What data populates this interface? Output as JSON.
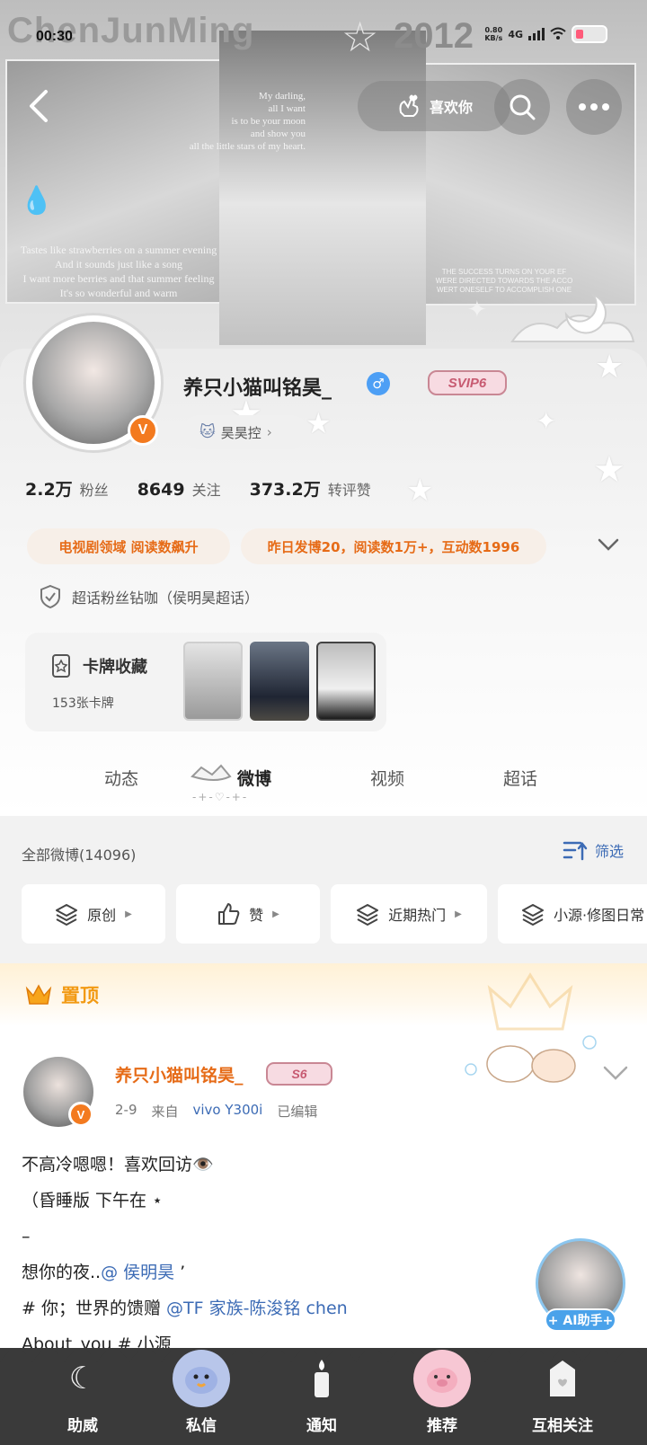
{
  "status_bar": {
    "time": "00:30",
    "speed_value": "0.80",
    "speed_unit": "KB/s",
    "network": "4G"
  },
  "cover": {
    "brand": "ChenJunMing",
    "year": "2012",
    "text_left": [
      "Tastes like strawberries on a summer evening",
      "And it sounds just like a song",
      "I want more berries and that summer feeling",
      "It's so wonderful and warm"
    ],
    "text_mid": [
      "My darling,",
      "all I want",
      "is to be your moon",
      "and show you",
      "all the little stars of my heart."
    ],
    "text_right": [
      "THE SUCCESS TURNS ON YOUR EF",
      "WERE DIRECTED TOWARDS THE ACCO",
      "WERT ONESELF TO ACCOMPLISH ONE"
    ]
  },
  "nav": {
    "like_label": "喜欢你"
  },
  "profile": {
    "nickname": "养只小猫叫铭昊_",
    "gender_symbol": "♂",
    "svip": "SVIP6",
    "fan_tag": "昊昊控",
    "verified_badge": "V",
    "stats": [
      {
        "num": "2.2万",
        "label": "粉丝"
      },
      {
        "num": "8649",
        "label": "关注"
      },
      {
        "num": "373.2万",
        "label": "转评赞"
      }
    ],
    "pill_1": "电视剧领域  阅读数飙升",
    "pill_2": "昨日发博20，阅读数1万+，互动数1996",
    "chaohua": "超话粉丝钻咖（侯明昊超话）",
    "cards_title": "卡牌收藏",
    "cards_count": "153张卡牌"
  },
  "tabs": [
    {
      "label": "动态"
    },
    {
      "label": "微博"
    },
    {
      "label": "视频"
    },
    {
      "label": "超话"
    }
  ],
  "filter": {
    "all_label": "全部微博(14096)",
    "sift_label": "筛选",
    "chips": [
      "原创",
      "赞",
      "近期热门",
      "小源·修图日常"
    ]
  },
  "pinned": {
    "label": "置顶"
  },
  "post": {
    "name": "养只小猫叫铭昊_",
    "level": "S6",
    "date": "2-9",
    "from": "来自",
    "device": "vivo   Y300i",
    "edited": "已编辑",
    "line1": "不高冷嗯嗯！喜欢回访👁️",
    "line2": "（昏睡版   下午在 ⋆",
    "line3": "–",
    "line4_text": "想你的夜..",
    "line4_link": "@ 侯明昊",
    "line4_tail": "  ’",
    "line5_text": "# 你；世界的馈赠 ",
    "line5_link": "@TF 家族-陈浚铭 chen",
    "line6": "About you  # 小源"
  },
  "ai_assistant": "+ AI助手+",
  "bottom_nav": [
    {
      "label": "助威",
      "icon": "moon-icon"
    },
    {
      "label": "私信",
      "icon": "bird-icon"
    },
    {
      "label": "通知",
      "icon": "candle-icon"
    },
    {
      "label": "推荐",
      "icon": "pig-icon"
    },
    {
      "label": "互相关注",
      "icon": "milk-box-icon"
    }
  ],
  "colors": {
    "accent_orange": "#e66b17",
    "link_blue": "#3c6bb5",
    "pinned_gold": "#f29a14",
    "ai_blue": "#4aa2ea"
  }
}
